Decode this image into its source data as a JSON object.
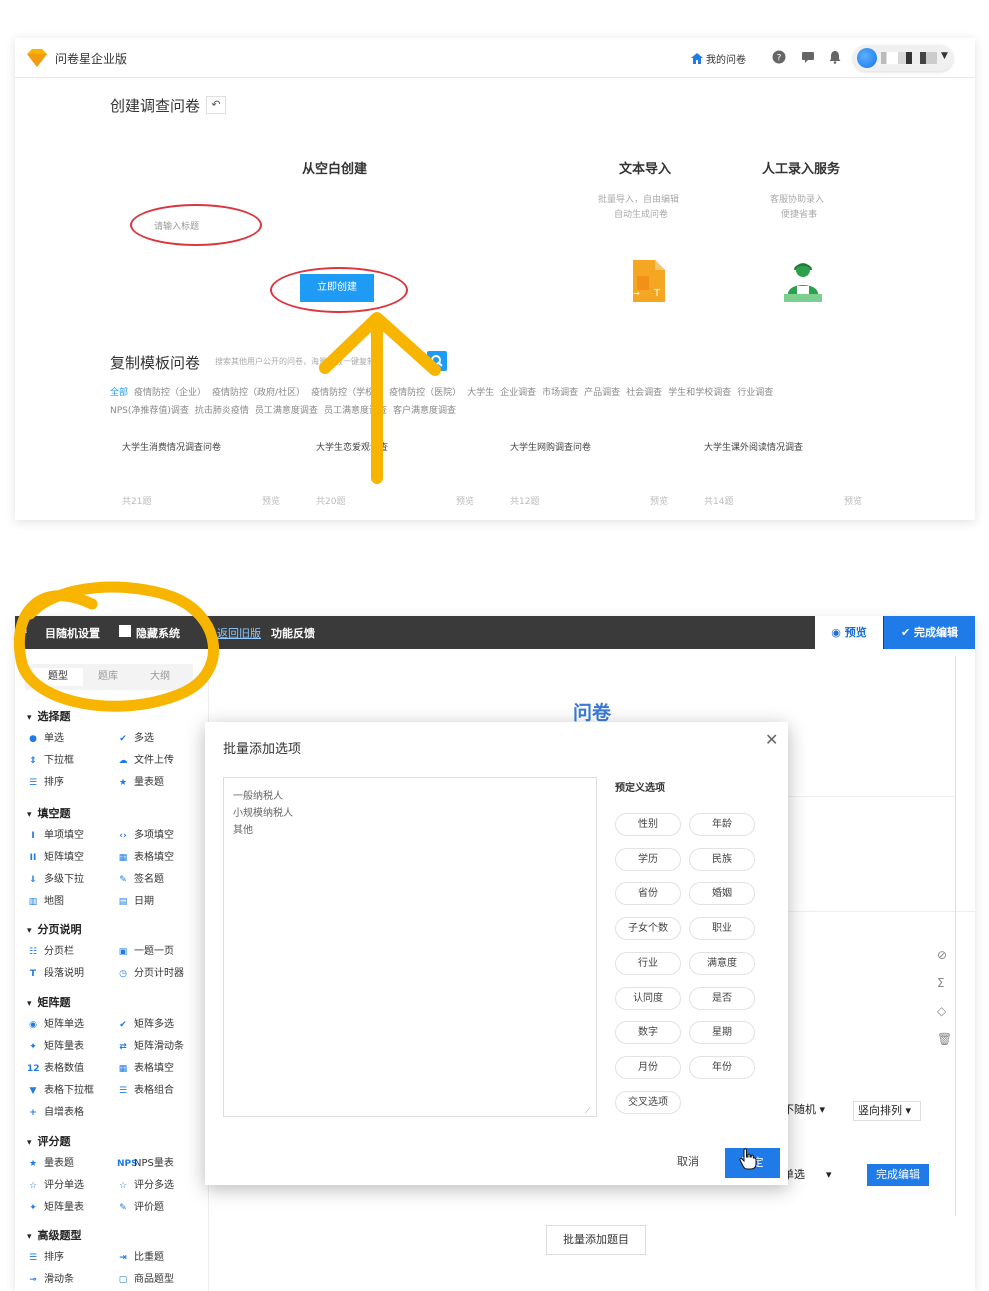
{
  "top": {
    "brand": "问卷星企业版",
    "my_survey": "我的问卷",
    "create_title": "创建调查问卷",
    "blank": {
      "title": "从空白创建",
      "input_placeholder": "请输入标题",
      "create_button": "立即创建"
    },
    "import": {
      "title": "文本导入",
      "desc1": "批量导入，自由编辑",
      "desc2": "自动生成问卷"
    },
    "manual": {
      "title": "人工录入服务",
      "desc1": "客服协助录入",
      "desc2": "便捷省事"
    },
    "template": {
      "title": "复制模板问卷",
      "search_placeholder": "搜索其他用户公开的问卷，海量模板一键复制",
      "categories_row1": [
        "全部",
        "疫情防控（企业）",
        "疫情防控（政府/社区）",
        "疫情防控（学校）",
        "疫情防控（医院）",
        "大学生",
        "企业调查",
        "市场调查",
        "产品调查",
        "社会调查",
        "学生和学校调查",
        "行业调查"
      ],
      "categories_row2": [
        "NPS(净推荐值)调查",
        "抗击肺炎疫情",
        "员工满意度调查",
        "员工满意度调查",
        "客户满意度调查"
      ],
      "cards": [
        {
          "name": "大学生消费情况调查问卷",
          "count": "共21题",
          "preview": "预览"
        },
        {
          "name": "大学生恋爱观调查",
          "count": "共20题",
          "preview": "预览"
        },
        {
          "name": "大学生网购调查问卷",
          "count": "共12题",
          "preview": "预览"
        },
        {
          "name": "大学生课外阅读情况调查",
          "count": "共14题",
          "preview": "预览"
        }
      ]
    }
  },
  "editor": {
    "toolbar": {
      "random_setting": "目随机设置",
      "hide_system": "隐藏系统",
      "back_old": "返回旧版",
      "feedback": "功能反馈",
      "preview": "预览",
      "finish": "完成编辑"
    },
    "left_tabs": [
      "题型",
      "题库",
      "大纲"
    ],
    "sections": [
      {
        "title": "选择题",
        "items": [
          [
            "单选",
            "多选"
          ],
          [
            "下拉框",
            "文件上传"
          ],
          [
            "排序",
            "量表题"
          ]
        ]
      },
      {
        "title": "填空题",
        "items": [
          [
            "单项填空",
            "多项填空"
          ],
          [
            "矩阵填空",
            "表格填空"
          ],
          [
            "多级下拉",
            "签名题"
          ],
          [
            "地图",
            "日期"
          ]
        ]
      },
      {
        "title": "分页说明",
        "items": [
          [
            "分页栏",
            "一题一页"
          ],
          [
            "段落说明",
            "分页计时器"
          ]
        ]
      },
      {
        "title": "矩阵题",
        "items": [
          [
            "矩阵单选",
            "矩阵多选"
          ],
          [
            "矩阵量表",
            "矩阵滑动条"
          ],
          [
            "表格数值",
            "表格填空"
          ],
          [
            "表格下拉框",
            "表格组合"
          ],
          [
            "自增表格",
            ""
          ]
        ]
      },
      {
        "title": "评分题",
        "items": [
          [
            "量表题",
            "NPS量表"
          ],
          [
            "评分单选",
            "评分多选"
          ],
          [
            "矩阵量表",
            "评价题"
          ]
        ]
      },
      {
        "title": "高级题型",
        "items": [
          [
            "排序",
            "比重题"
          ],
          [
            "滑动条",
            "商品题型"
          ]
        ]
      }
    ],
    "survey_title": "问卷",
    "rand_select": "不随机",
    "arrange_select": "竖向排列",
    "single_select": "单选",
    "finish_edit": "完成编辑",
    "batch_add": "批量添加题目"
  },
  "modal": {
    "title": "批量添加选项",
    "options_text": "一般纳税人\n小规模纳税人\n其他",
    "predef_title": "预定义选项",
    "chips": [
      "性别",
      "年龄",
      "学历",
      "民族",
      "省份",
      "婚姻",
      "子女个数",
      "职业",
      "行业",
      "满意度",
      "认同度",
      "是否",
      "数字",
      "星期",
      "月份",
      "年份",
      "交叉选项"
    ],
    "cancel": "取消",
    "ok": "确定"
  },
  "colors": {
    "brand_blue": "#1e9bf5",
    "primary_blue": "#1e7be8",
    "annotation_red": "#d9363e",
    "annotation_yellow": "#f7b500"
  }
}
